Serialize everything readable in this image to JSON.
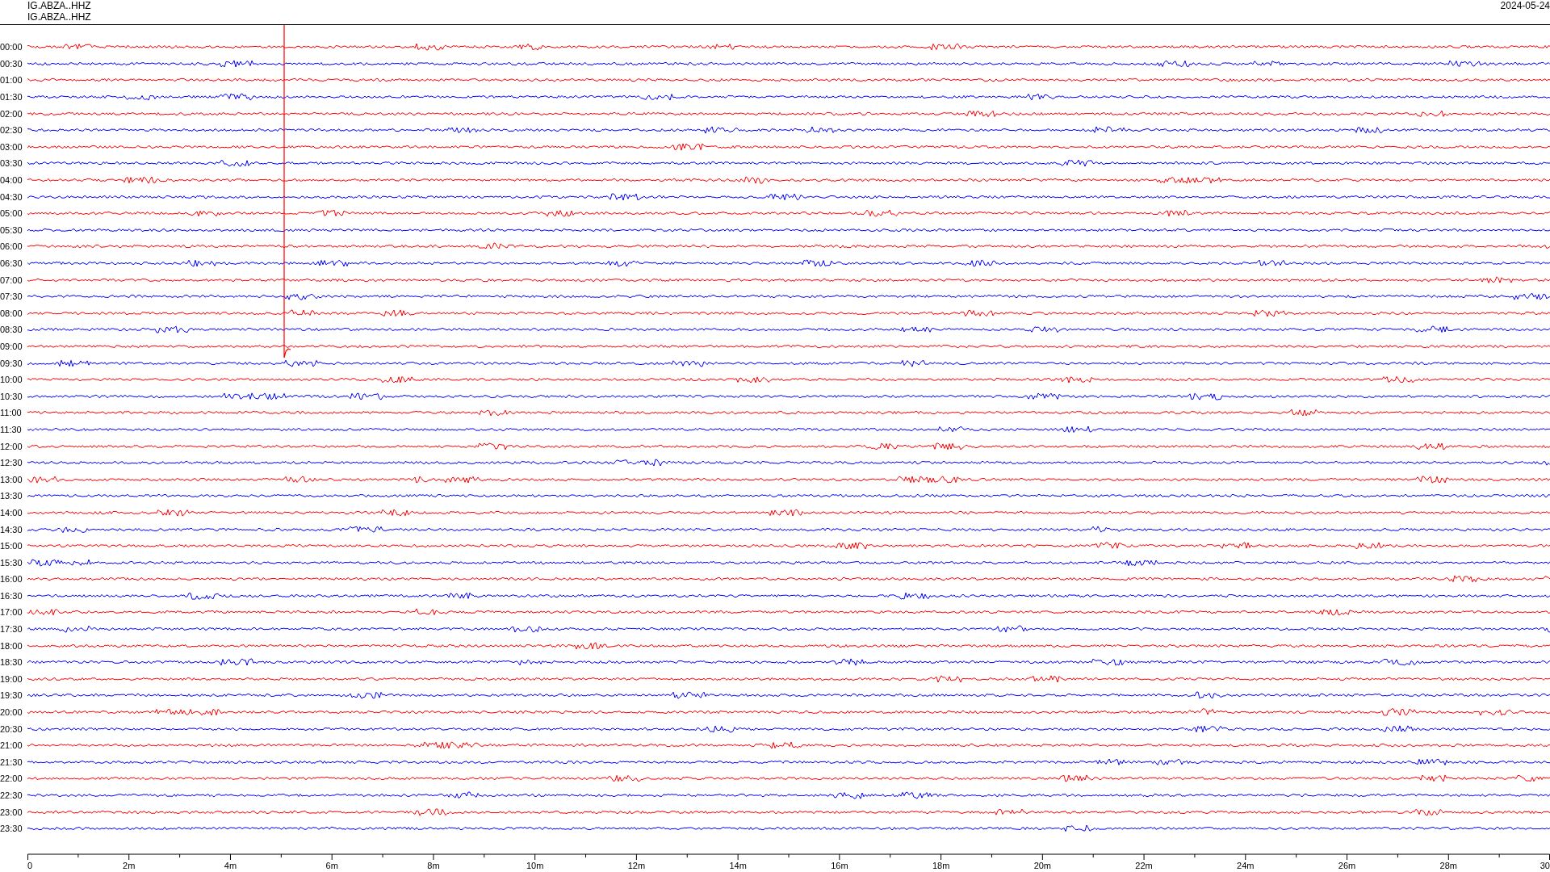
{
  "header": {
    "channel_lines": [
      "IG.ABZA..HHZ",
      "IG.ABZA..HHZ"
    ],
    "date": "2024-05-24"
  },
  "traces": [
    {
      "label": "00:00",
      "color": "#ff0000"
    },
    {
      "label": "00:30",
      "color": "#0000ff"
    },
    {
      "label": "01:00",
      "color": "#ff0000"
    },
    {
      "label": "01:30",
      "color": "#0000ff"
    },
    {
      "label": "02:00",
      "color": "#ff0000"
    },
    {
      "label": "02:30",
      "color": "#0000ff"
    },
    {
      "label": "03:00",
      "color": "#ff0000"
    },
    {
      "label": "03:30",
      "color": "#0000ff"
    },
    {
      "label": "04:00",
      "color": "#ff0000"
    },
    {
      "label": "04:30",
      "color": "#0000ff"
    },
    {
      "label": "05:00",
      "color": "#ff0000"
    },
    {
      "label": "05:30",
      "color": "#0000ff"
    },
    {
      "label": "06:00",
      "color": "#ff0000"
    },
    {
      "label": "06:30",
      "color": "#0000ff"
    },
    {
      "label": "07:00",
      "color": "#ff0000"
    },
    {
      "label": "07:30",
      "color": "#0000ff"
    },
    {
      "label": "08:00",
      "color": "#ff0000"
    },
    {
      "label": "08:30",
      "color": "#0000ff"
    },
    {
      "label": "09:00",
      "color": "#ff0000"
    },
    {
      "label": "09:30",
      "color": "#0000ff"
    },
    {
      "label": "10:00",
      "color": "#ff0000"
    },
    {
      "label": "10:30",
      "color": "#0000ff"
    },
    {
      "label": "11:00",
      "color": "#ff0000"
    },
    {
      "label": "11:30",
      "color": "#0000ff"
    },
    {
      "label": "12:00",
      "color": "#ff0000"
    },
    {
      "label": "12:30",
      "color": "#0000ff"
    },
    {
      "label": "13:00",
      "color": "#ff0000"
    },
    {
      "label": "13:30",
      "color": "#0000ff"
    },
    {
      "label": "14:00",
      "color": "#ff0000"
    },
    {
      "label": "14:30",
      "color": "#0000ff"
    },
    {
      "label": "15:00",
      "color": "#ff0000"
    },
    {
      "label": "15:30",
      "color": "#0000ff"
    },
    {
      "label": "16:00",
      "color": "#ff0000"
    },
    {
      "label": "16:30",
      "color": "#0000ff"
    },
    {
      "label": "17:00",
      "color": "#ff0000"
    },
    {
      "label": "17:30",
      "color": "#0000ff"
    },
    {
      "label": "18:00",
      "color": "#ff0000"
    },
    {
      "label": "18:30",
      "color": "#0000ff"
    },
    {
      "label": "19:00",
      "color": "#ff0000"
    },
    {
      "label": "19:30",
      "color": "#0000ff"
    },
    {
      "label": "20:00",
      "color": "#ff0000"
    },
    {
      "label": "20:30",
      "color": "#0000ff"
    },
    {
      "label": "21:00",
      "color": "#ff0000"
    },
    {
      "label": "21:30",
      "color": "#0000ff"
    },
    {
      "label": "22:00",
      "color": "#ff0000"
    },
    {
      "label": "22:30",
      "color": "#0000ff"
    },
    {
      "label": "23:00",
      "color": "#ff0000"
    },
    {
      "label": "23:30",
      "color": "#0000ff"
    }
  ],
  "time_axis": {
    "labels": [
      "0",
      "2m",
      "4m",
      "6m",
      "8m",
      "10m",
      "12m",
      "14m",
      "16m",
      "18m",
      "20m",
      "22m",
      "24m",
      "26m",
      "28m",
      "30"
    ]
  }
}
